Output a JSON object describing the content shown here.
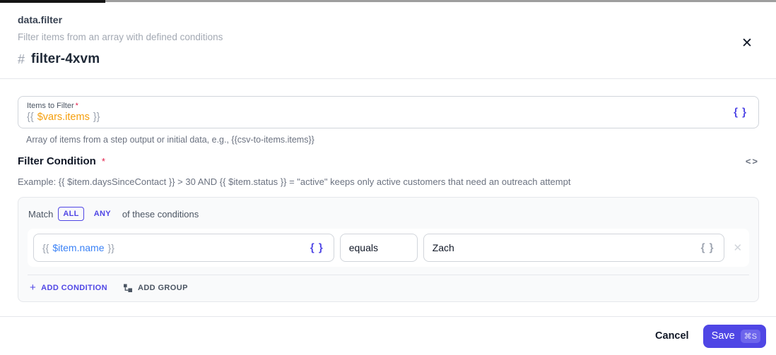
{
  "header": {
    "step_type": "data.filter",
    "step_description": "Filter items from an array with defined conditions",
    "hash_symbol": "#",
    "step_name": "filter-4xvm",
    "close_glyph": "✕"
  },
  "items_field": {
    "label": "Items to Filter",
    "required_marker": "*",
    "value_prefix": "{{",
    "value_expression": "$vars.items",
    "value_suffix": "}}",
    "expression_icon": "{ }",
    "helper": "Array of items from a step output or initial data, e.g., {{csv-to-items.items}}"
  },
  "filter_condition": {
    "label": "Filter Condition",
    "required_marker": "*",
    "code_icon": "<>",
    "example": "Example: {{ $item.daysSinceContact }} > 30 AND {{ $item.status }} = \"active\" keeps only active customers that need an outreach attempt"
  },
  "condition_group": {
    "match_label": "Match",
    "match_all": "ALL",
    "match_any": "ANY",
    "match_suffix": "of these conditions",
    "conditions": [
      {
        "field_prefix": "{{",
        "field_expression": "$item.name",
        "field_suffix": "}}",
        "field_expression_icon": "{ }",
        "operator": "equals",
        "value": "Zach",
        "value_expression_icon": "{ }",
        "remove_glyph": "✕"
      }
    ],
    "add_condition_plus": "+",
    "add_condition_label": "ADD CONDITION",
    "add_group_label": "ADD GROUP"
  },
  "footer": {
    "cancel_label": "Cancel",
    "save_label": "Save",
    "save_shortcut": "⌘S"
  },
  "colors": {
    "accent": "#4f46e5",
    "expression_orange": "#f59e0b",
    "expression_blue": "#3b82f6",
    "required_red": "#e11d48",
    "progress_black": "#141414",
    "progress_gray": "#9e9e9e"
  }
}
